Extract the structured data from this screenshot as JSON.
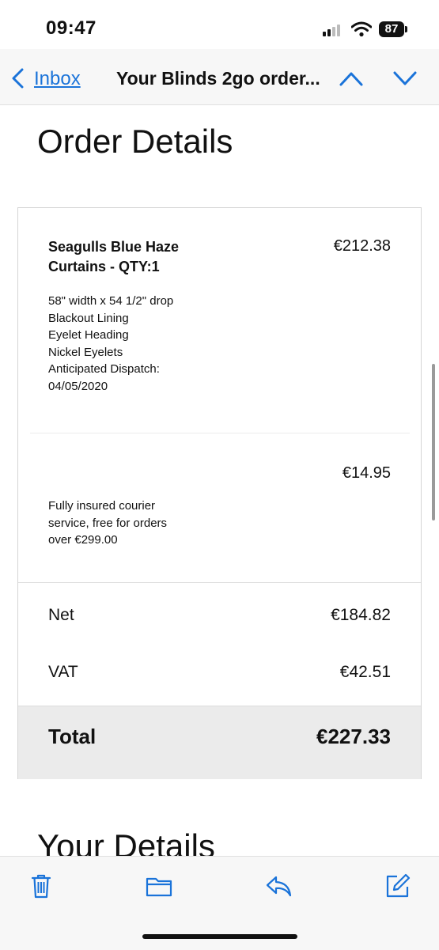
{
  "status_bar": {
    "time": "09:47",
    "battery": "87"
  },
  "nav": {
    "back_label": "Inbox",
    "title": "Your Blinds 2go order..."
  },
  "order": {
    "title": "Order Details",
    "item": {
      "name_line1": "Seagulls Blue Haze",
      "name_line2": "Curtains - QTY:1",
      "price": "€212.38",
      "details": [
        "58\" width x 54 1/2\" drop",
        "Blackout Lining",
        "Eyelet Heading",
        "Nickel Eyelets",
        "Anticipated Dispatch:",
        "04/05/2020"
      ]
    },
    "shipping": {
      "price": "€14.95",
      "desc_lines": [
        "Fully insured courier",
        "service, free for orders",
        "over €299.00"
      ]
    },
    "net": {
      "label": "Net",
      "value": "€184.82"
    },
    "vat": {
      "label": "VAT",
      "value": "€42.51"
    },
    "total": {
      "label": "Total",
      "value": "€227.33"
    }
  },
  "next_section_title": "Your Details",
  "toolbar": {
    "icons": [
      "trash-icon",
      "folder-icon",
      "reply-icon",
      "compose-icon"
    ]
  },
  "colors": {
    "accent": "#1a73d9",
    "total_band": "#ebebeb"
  }
}
